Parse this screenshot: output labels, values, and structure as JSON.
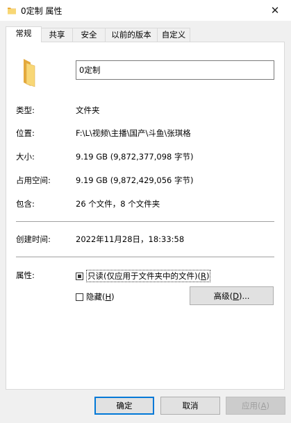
{
  "window": {
    "title": "0定制 属性",
    "close_glyph": "✕"
  },
  "tabs": [
    "常规",
    "共享",
    "安全",
    "以前的版本",
    "自定义"
  ],
  "general": {
    "folder_name": "0定制",
    "type_label": "类型:",
    "type_value": "文件夹",
    "location_label": "位置:",
    "location_value": "F:\\L\\视频\\主播\\国产\\斗鱼\\张琪格",
    "size_label": "大小:",
    "size_value": "9.19 GB (9,872,377,098 字节)",
    "disk_size_label": "占用空间:",
    "disk_size_value": "9.19 GB (9,872,429,056 字节)",
    "contains_label": "包含:",
    "contains_value": "26 个文件，8 个文件夹",
    "created_label": "创建时间:",
    "created_value": "2022年11月28日，18:33:58",
    "attributes_label": "属性:",
    "readonly_text": "只读(仅应用于文件夹中的文件)(",
    "readonly_key": "R",
    "readonly_end": ")",
    "readonly_state": "indeterminate",
    "hidden_text": "隐藏(",
    "hidden_key": "H",
    "hidden_end": ")",
    "advanced_text": "高级(",
    "advanced_key": "D",
    "advanced_end": ")..."
  },
  "buttons": {
    "ok": "确定",
    "cancel": "取消",
    "apply_text": "应用(",
    "apply_key": "A",
    "apply_end": ")"
  },
  "colors": {
    "folder": "#f4c04e",
    "default_button_border": "#0078d7"
  }
}
